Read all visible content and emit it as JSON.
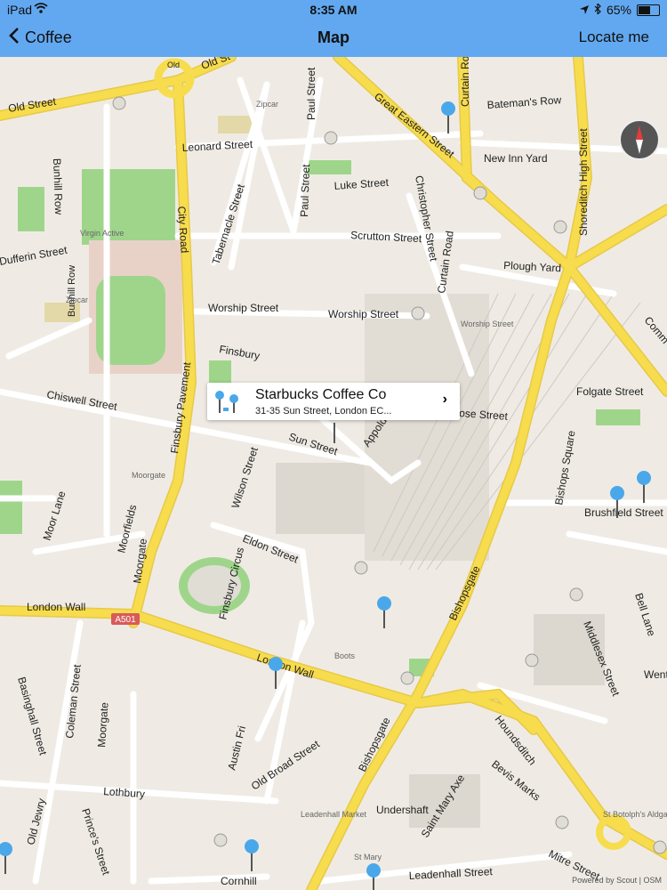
{
  "status_bar": {
    "carrier": "iPad",
    "time": "8:35 AM",
    "battery": "65%",
    "battery_level": 0.65
  },
  "nav": {
    "back_label": "Coffee",
    "title": "Map",
    "right_action": "Locate me"
  },
  "callout": {
    "title": "Starbucks Coffee Co",
    "address": "31-35 Sun Street, London EC...",
    "chevron": "›"
  },
  "map": {
    "credit": "Powered by Scout | OSM",
    "road_shield": "A501",
    "streets": {
      "old_street": "Old Street",
      "old_st_top": "Old St",
      "old_st_circle": "Old",
      "great_eastern": "Great Eastern Street",
      "curtain": "Curtain Road",
      "batemans": "Bateman's Row",
      "leonard": "Leonard Street",
      "paul": "Paul Street",
      "new_inn": "New Inn Yard",
      "shoreditch": "Shoreditch High Street",
      "bunhill_top": "Bunhill Row",
      "luke": "Luke Street",
      "city_road": "City Road",
      "tabernacle": "Tabernacle Street",
      "scrutton": "Scrutton Street",
      "plough": "Plough Yard",
      "worship1": "Worship Street",
      "worship2": "Worship Street",
      "finsbury": "Finsbury",
      "chiswell": "Chiswell Street",
      "folgate": "Folgate Street",
      "sun": "Sun Street",
      "appold": "Appold",
      "wilson": "Wilson Street",
      "moor_lane": "Moor Lane",
      "moorfields": "Moorfields",
      "eldon": "Eldon Street",
      "finsbury_circus": "Finsbury Circus",
      "finsbury_pavement": "Finsbury Pavement",
      "bishopsgate": "Bishopsgate",
      "bishops_square": "Bishops Square",
      "brushfield": "Brushfield Street",
      "london_wall_1": "London Wall",
      "london_wall_2": "London Wall",
      "moorgate": "Moorgate",
      "middlesex": "Middlesex Street",
      "bell_lane": "Bell Lane",
      "basinghall": "Basinghall Street",
      "coleman": "Coleman Street",
      "moorgate2": "Moorgate",
      "houndsditch": "Houndsditch",
      "bevis": "Bevis Marks",
      "old_broad": "Old Broad Street",
      "bishopsgate2": "Bishopsgate",
      "lothbury": "Lothbury",
      "old_jewry": "Old Jewry",
      "princes": "Prince's Street",
      "undershaft": "Undershaft",
      "st_mary_axe": "Saint Mary Axe",
      "mitre": "Mitre Street",
      "leadenhall": "Leadenhall Street",
      "cornhill": "Cornhill",
      "bunhill_row": "Bunhill Row",
      "crucifix_left": "Street",
      "dufferin": "Dufferin Street",
      "eld": "Eld Street",
      "commercial": "Comm",
      "went": "Went",
      "ose": "ose Street",
      "austin": "Austin Fri",
      "poldo": "Christopher Street"
    },
    "places": {
      "virgin": "Virgin Active",
      "zipcar1": "Zipcar",
      "zipcar2": "Zipcar",
      "worship_st": "Worship Street",
      "moorgate_stn": "Moorgate",
      "boots": "Boots",
      "leadenhall_mkt": "Leadenhall Market",
      "st_botolph": "St Botolph's Aldgate",
      "st_mary": "St Mary"
    }
  },
  "colors": {
    "nav_bg": "#62a8f0",
    "map_bg": "#efebe4",
    "major_road": "#f7dc4d",
    "park": "#9fd58b",
    "pin": "#4aa8ea"
  },
  "icons": [
    "back-chevron-icon",
    "wifi-icon",
    "location-arrow-icon",
    "bluetooth-icon",
    "battery-icon",
    "compass-icon",
    "map-pin-icon",
    "chevron-right-icon",
    "coffee-cluster-icon"
  ]
}
